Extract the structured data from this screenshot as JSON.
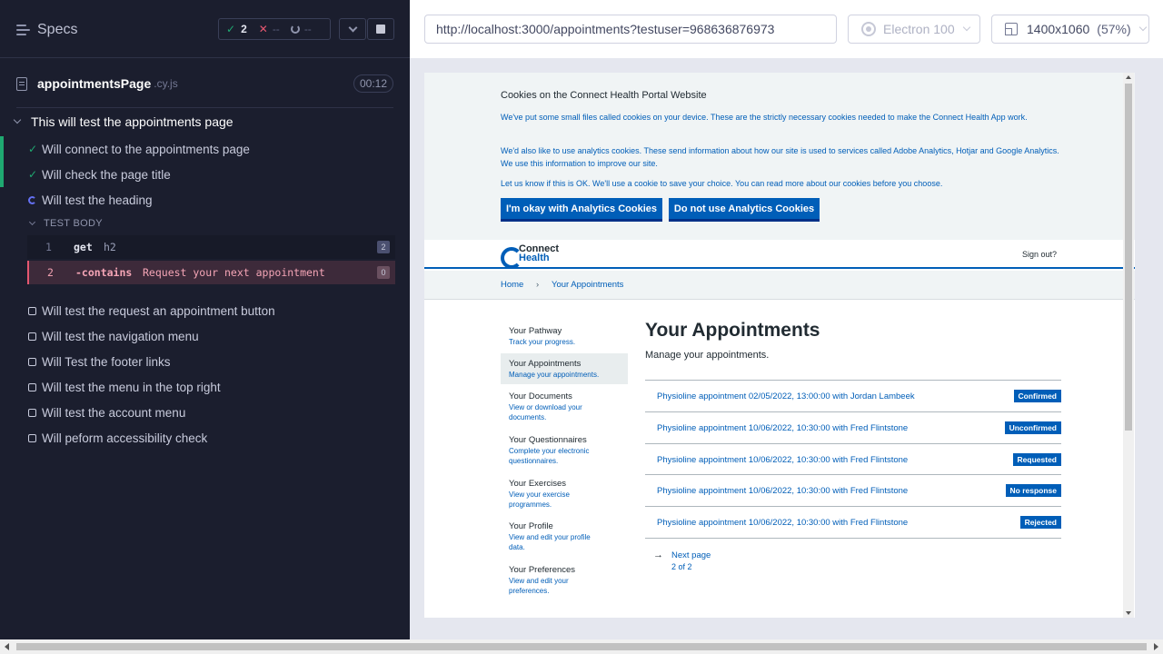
{
  "runner": {
    "specs_label": "Specs",
    "stats": {
      "passed": "2",
      "failed": "--",
      "pending": "--"
    },
    "file": {
      "name": "appointmentsPage",
      "ext": ".cy.js",
      "duration": "00:12"
    },
    "suite_title": "This will test the appointments page",
    "tests": [
      {
        "label": "Will connect to the appointments page",
        "state": "passed"
      },
      {
        "label": "Will check the page title",
        "state": "passed"
      },
      {
        "label": "Will test the heading",
        "state": "running"
      },
      {
        "label": "Will test the request an appointment button",
        "state": "pending"
      },
      {
        "label": "Will test the navigation menu",
        "state": "pending"
      },
      {
        "label": "Will Test the footer links",
        "state": "pending"
      },
      {
        "label": "Will test the menu in the top right",
        "state": "pending"
      },
      {
        "label": "Will test the account menu",
        "state": "pending"
      },
      {
        "label": "Will peform accessibility check",
        "state": "pending"
      }
    ],
    "test_body_label": "TEST BODY",
    "commands": [
      {
        "num": "1",
        "name": "get",
        "message": "h2",
        "count": "2"
      },
      {
        "num": "2",
        "name": "-contains",
        "message": "Request your next appointment",
        "count": "0"
      }
    ]
  },
  "toolbar": {
    "url": "http://localhost:3000/appointments?testuser=968636876973",
    "browser": "Electron 100",
    "viewport": "1400x1060",
    "scale": "(57%)"
  },
  "app": {
    "cookie": {
      "title": "Cookies on the Connect Health Portal Website",
      "p1": "We've put some small files called cookies on your device. These are the strictly necessary cookies needed to make the Connect Health App work.",
      "p2": "We'd also like to use analytics cookies. These send information about how our site is used to services called Adobe Analytics, Hotjar and Google Analytics. We use this information to improve our site.",
      "p3": "Let us know if this is OK. We'll use a cookie to save your choice. You can read more about our cookies before you choose.",
      "accept_label": "I'm okay with Analytics Cookies",
      "reject_label": "Do not use Analytics Cookies"
    },
    "logo": {
      "line1": "Connect",
      "line2": "Health"
    },
    "signout_label": "Sign out?",
    "breadcrumb": {
      "home": "Home",
      "separator": "›",
      "current": "Your Appointments"
    },
    "nav": [
      {
        "title": "Your Pathway",
        "sub": "Track your progress."
      },
      {
        "title": "Your Appointments",
        "sub": "Manage your appointments."
      },
      {
        "title": "Your Documents",
        "sub": "View or download your documents."
      },
      {
        "title": "Your Questionnaires",
        "sub": "Complete your electronic questionnaires."
      },
      {
        "title": "Your Exercises",
        "sub": "View your exercise programmes."
      },
      {
        "title": "Your Profile",
        "sub": "View and edit your profile data."
      },
      {
        "title": "Your Preferences",
        "sub": "View and edit your preferences."
      }
    ],
    "heading": "Your Appointments",
    "subheading": "Manage your appointments.",
    "appointments": [
      {
        "text": "Physioline appointment 02/05/2022, 13:00:00 with Jordan Lambeek",
        "status": "Confirmed"
      },
      {
        "text": "Physioline appointment 10/06/2022, 10:30:00 with Fred Flintstone",
        "status": "Unconfirmed"
      },
      {
        "text": "Physioline appointment 10/06/2022, 10:30:00 with Fred Flintstone",
        "status": "Requested"
      },
      {
        "text": "Physioline appointment 10/06/2022, 10:30:00 with Fred Flintstone",
        "status": "No response"
      },
      {
        "text": "Physioline appointment 10/06/2022, 10:30:00 with Fred Flintstone",
        "status": "Rejected"
      }
    ],
    "pagination": {
      "arrow": "→",
      "label": "Next page",
      "count": "2 of 2"
    }
  },
  "colors": {
    "runner_bg": "#1b1e2e",
    "pass": "#1fa971",
    "fail": "#e45770",
    "brand_blue": "#005eb8"
  }
}
